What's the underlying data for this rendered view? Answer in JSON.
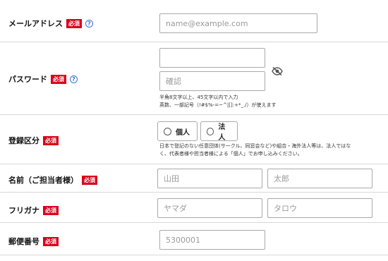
{
  "required_badge": "必須",
  "help_icon_glyph": "?",
  "email": {
    "label": "メールアドレス",
    "placeholder": "name@example.com"
  },
  "password": {
    "label": "パスワード",
    "value": "",
    "confirm_placeholder": "確認",
    "note_line1": "半角8文字以上、45文字以内で入力",
    "note_line2": "英数、一部記号（!#$%-=~^|[]:+*_./）が使えます",
    "visibility_icon": "eye-slash-icon"
  },
  "registration_type": {
    "label": "登録区分",
    "options": [
      "個人",
      "法人"
    ],
    "note_line1": "日本で登記のない任意団体(サークル、同窓会など)や組合・海外法人等は、法人ではな",
    "note_line2": "く、代表者様や担当者様による「個人」でお申し込みください。"
  },
  "name": {
    "label": "名前（ご担当者様）",
    "last_placeholder": "山田",
    "first_placeholder": "太郎"
  },
  "furigana": {
    "label": "フリガナ",
    "last_placeholder": "ヤマダ",
    "first_placeholder": "タロウ"
  },
  "postal_code": {
    "label": "郵便番号",
    "placeholder": "5300001"
  },
  "colors": {
    "required_badge": "#d9001b",
    "help_icon": "#3b6fd0",
    "border": "#a9a9a9"
  }
}
